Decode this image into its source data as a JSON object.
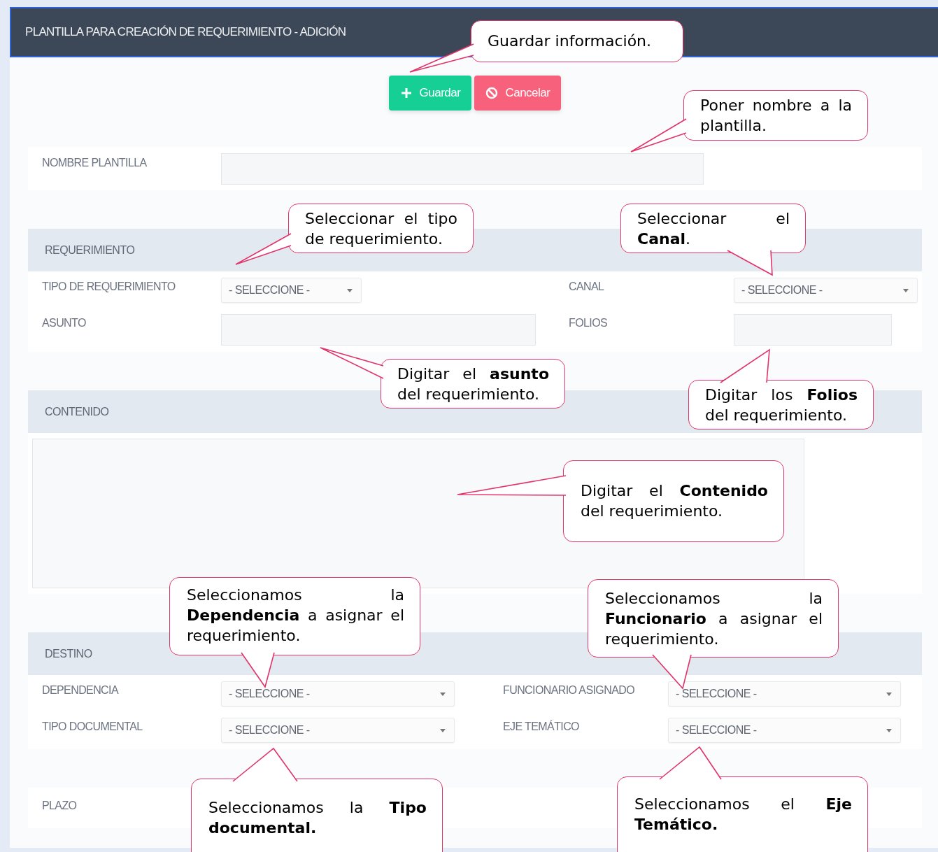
{
  "header": {
    "title": "PLANTILLA PARA CREACIÓN DE REQUERIMIENTO - ADICIÓN"
  },
  "buttons": [
    {
      "label": "Guardar",
      "kind": "save"
    },
    {
      "label": "Cancelar",
      "kind": "cancel"
    }
  ],
  "name_row": {
    "label": "NOMBRE PLANTILLA",
    "kind": "text"
  },
  "sections": [
    {
      "title": "REQUERIMIENTO",
      "fields": [
        {
          "label": "TIPO DE REQUERIMIENTO",
          "kind": "select",
          "value": "- SELECCIONE -"
        },
        {
          "label": "CANAL",
          "kind": "select",
          "value": "- SELECCIONE -"
        },
        {
          "label": "ASUNTO",
          "kind": "text"
        },
        {
          "label": "FOLIOS",
          "kind": "text"
        }
      ]
    },
    {
      "title": "CONTENIDO",
      "fields": [
        {
          "kind": "textarea"
        }
      ]
    },
    {
      "title": "DESTINO",
      "fields": [
        {
          "label": "DEPENDENCIA",
          "kind": "select",
          "value": "- SELECCIONE -"
        },
        {
          "label": "FUNCIONARIO ASIGNADO",
          "kind": "select",
          "value": "- SELECCIONE -"
        },
        {
          "label": "TIPO DOCUMENTAL",
          "kind": "select",
          "value": "- SELECCIONE -"
        },
        {
          "label": "EJE TEMÁTICO",
          "kind": "select",
          "value": "- SELECCIONE -"
        }
      ]
    }
  ],
  "deadline_row": {
    "label": "PLAZO"
  },
  "callouts": [
    {
      "text": "Guardar información."
    },
    {
      "text": "Poner nombre a la plantilla."
    },
    {
      "text": "Seleccionar el tipo de requerimiento."
    },
    {
      "text": "Seleccionar el **Canal**."
    },
    {
      "text": "Digitar el **asunto** del requerimiento."
    },
    {
      "text": "Digitar los **Folios** del requerimiento."
    },
    {
      "text": "Digitar el **Contenido** del requerimiento."
    },
    {
      "text": "Seleccionamos la **Dependencia** a asignar el requerimiento."
    },
    {
      "text": "Seleccionamos la **Funcionario** a asignar el requerimiento."
    },
    {
      "text": "Seleccionamos la **Tipo documental.**"
    },
    {
      "text": "Seleccionamos el **Eje Temático.**"
    }
  ]
}
